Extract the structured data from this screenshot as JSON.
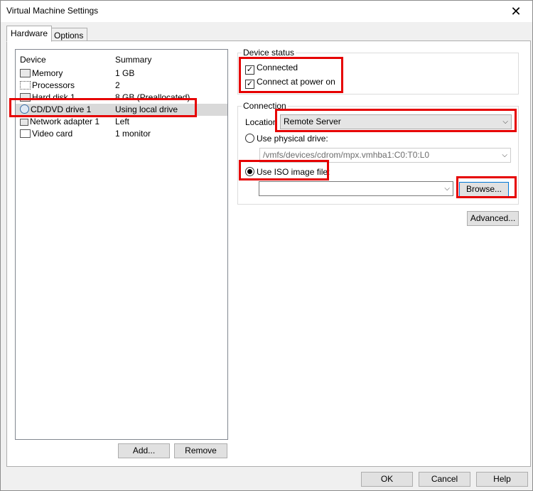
{
  "window": {
    "title": "Virtual Machine Settings",
    "close_glyph": "✕"
  },
  "tabs": [
    {
      "label": "Hardware",
      "active": true
    },
    {
      "label": "Options",
      "active": false
    }
  ],
  "device_list": {
    "columns": {
      "device": "Device",
      "summary": "Summary"
    },
    "rows": [
      {
        "icon": "memory-icon",
        "device": "Memory",
        "summary": "1 GB",
        "selected": false
      },
      {
        "icon": "processor-icon",
        "device": "Processors",
        "summary": "2",
        "selected": false
      },
      {
        "icon": "hard-disk-icon",
        "device": "Hard disk 1",
        "summary": "8 GB (Preallocated)",
        "selected": false
      },
      {
        "icon": "cd-dvd-icon",
        "device": "CD/DVD drive 1",
        "summary": "Using local drive",
        "selected": true
      },
      {
        "icon": "network-adapter-icon",
        "device": "Network adapter 1",
        "summary": "Left",
        "selected": false
      },
      {
        "icon": "monitor-icon",
        "device": "Video card",
        "summary": "1 monitor",
        "selected": false
      }
    ],
    "add_label": "Add...",
    "remove_label": "Remove"
  },
  "device_status": {
    "label": "Device status",
    "connected_label": "Connected",
    "connected_checked": true,
    "power_on_label": "Connect at power on",
    "power_on_checked": true
  },
  "connection": {
    "label": "Connection",
    "location_label": "Location",
    "location_value": "Remote Server",
    "physical_label": "Use physical drive:",
    "physical_value": "/vmfs/devices/cdrom/mpx.vmhba1:C0:T0:L0",
    "iso_label": "Use ISO image file:",
    "iso_value": "",
    "browse_label": "Browse...",
    "selected_mode": "iso"
  },
  "advanced_label": "Advanced...",
  "footer": {
    "ok_label": "OK",
    "cancel_label": "Cancel",
    "help_label": "Help"
  },
  "check_glyph": "✓",
  "dropdown_glyph": "⌵",
  "highlight_color": "#e60000"
}
